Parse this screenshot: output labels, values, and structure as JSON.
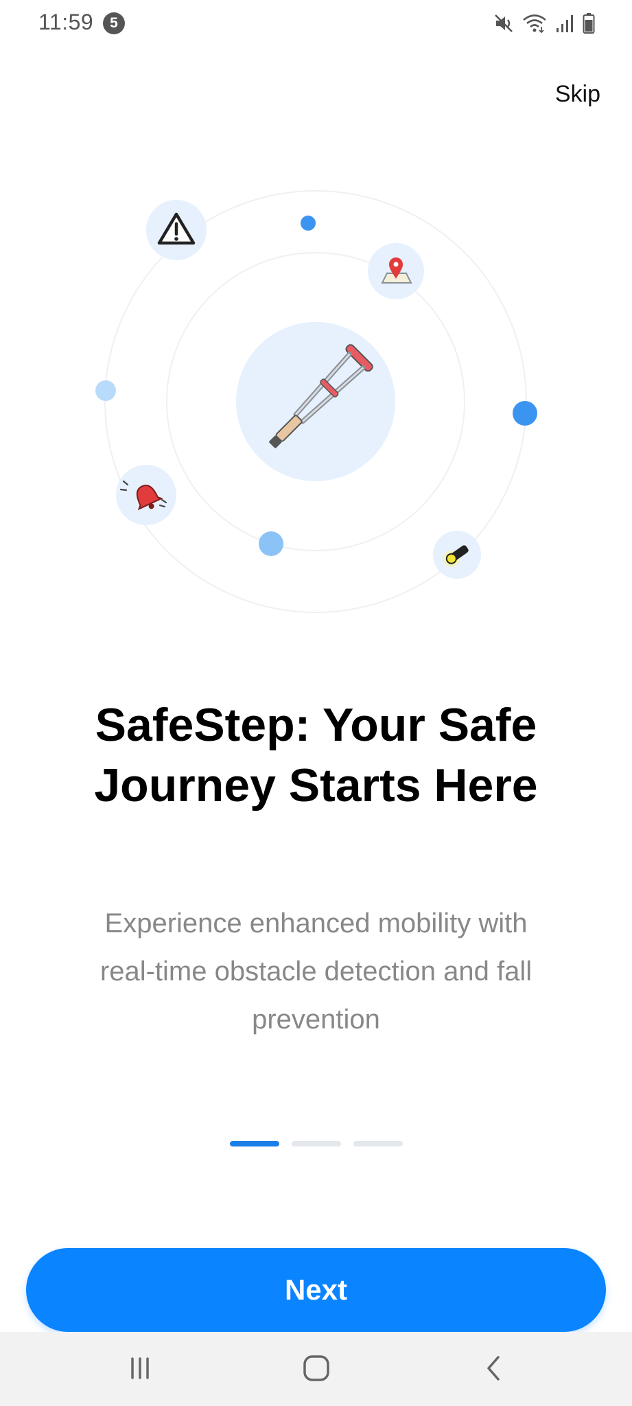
{
  "status_bar": {
    "time": "11:59",
    "notification_count": "5",
    "icons": [
      "mute-icon",
      "wifi-icon",
      "signal-icon",
      "battery-icon"
    ]
  },
  "header": {
    "skip_label": "Skip"
  },
  "illustration": {
    "center_icon": "crutch-icon",
    "orbit_icons": [
      "warning-icon",
      "map-pin-icon",
      "bell-icon",
      "flashlight-icon"
    ]
  },
  "content": {
    "title": "SafeStep: Your Safe Journey Starts Here",
    "description": "Experience enhanced mobility with real-time obstacle detection and fall prevention"
  },
  "pagination": {
    "total": 3,
    "current": 1
  },
  "footer": {
    "next_label": "Next"
  },
  "nav_bar": {
    "buttons": [
      "recent-apps-icon",
      "home-icon",
      "back-icon"
    ]
  },
  "colors": {
    "primary": "#0a84ff",
    "indicator_active": "#1a7fe8",
    "indicator_inactive": "#e4e7ec",
    "circle_fill": "#e6f1fd",
    "text_primary": "#000000",
    "text_secondary": "#888888"
  }
}
